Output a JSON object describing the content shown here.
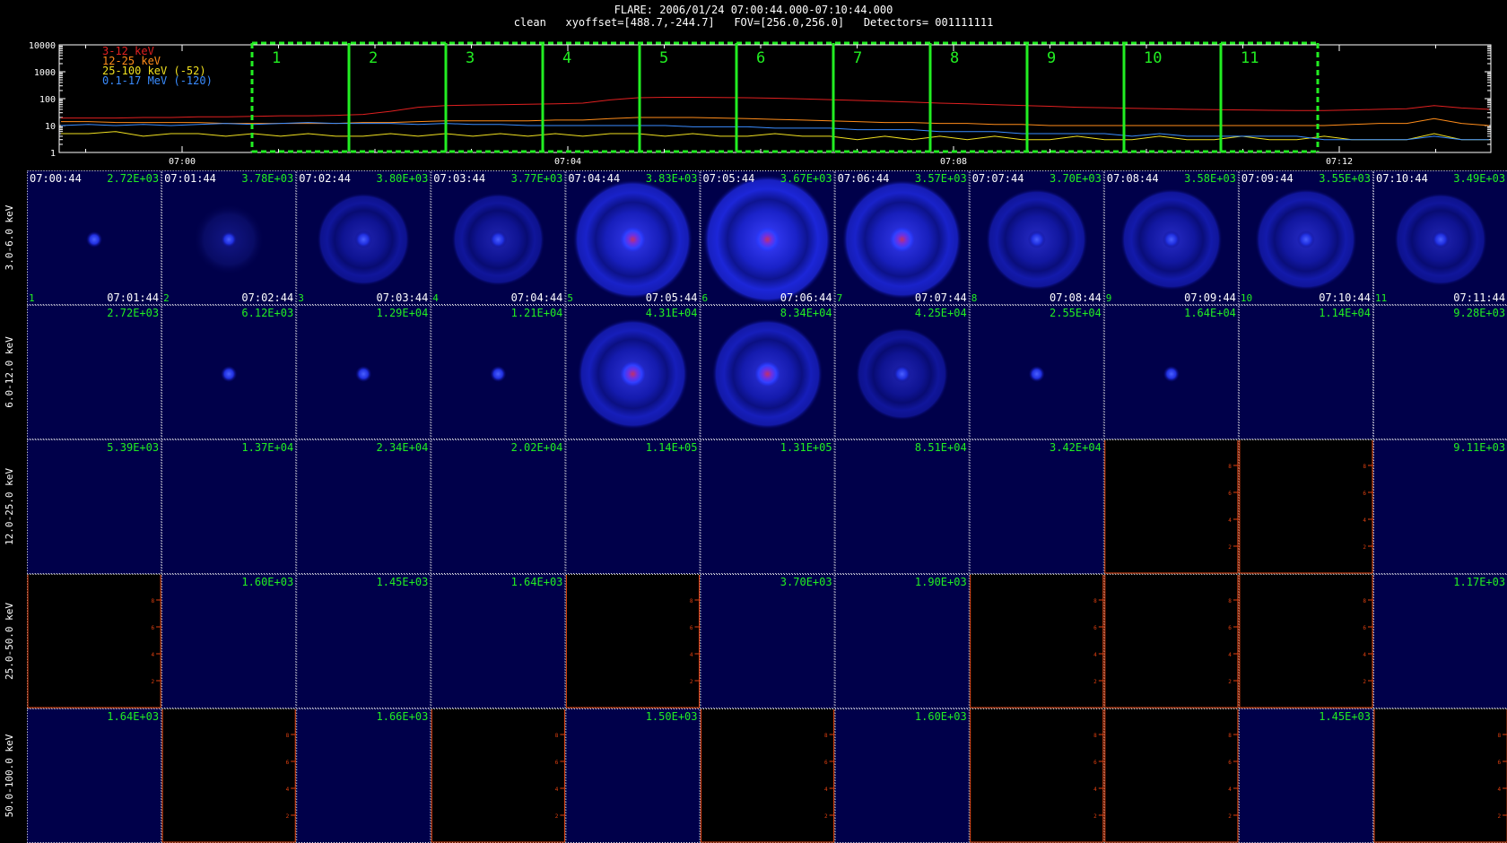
{
  "header": {
    "line1": "FLARE: 2006/01/24 07:00:44.000-07:10:44.000",
    "line2": "clean   xyoffset=[488.7,-244.7]   FOV=[256.0,256.0]   Detectors= 001111111"
  },
  "chart_data": {
    "type": "line",
    "yscale": "log",
    "ylim": [
      1,
      10000
    ],
    "yticks": [
      "1",
      "10",
      "100",
      "1000",
      "10000"
    ],
    "xticks": [
      "07:00",
      "07:04",
      "07:08",
      "07:12"
    ],
    "series": [
      {
        "name": "3-12 keV",
        "color": "#e02020",
        "values": [
          19,
          19,
          19,
          20,
          20,
          21,
          21,
          22,
          23,
          23,
          24,
          26,
          34,
          48,
          55,
          58,
          60,
          62,
          64,
          68,
          90,
          108,
          112,
          112,
          110,
          108,
          104,
          98,
          92,
          86,
          80,
          74,
          68,
          64,
          60,
          56,
          52,
          48,
          46,
          44,
          42,
          40,
          39,
          38,
          37,
          36,
          36,
          38,
          40,
          42,
          55,
          45,
          40
        ]
      },
      {
        "name": "12-25 keV",
        "color": "#ff8c1a",
        "values": [
          14,
          14,
          13,
          13,
          13,
          13,
          12,
          12,
          12,
          12,
          12,
          13,
          13,
          14,
          15,
          15,
          15,
          15,
          16,
          16,
          18,
          20,
          20,
          20,
          19,
          18,
          17,
          16,
          15,
          14,
          13,
          13,
          12,
          12,
          11,
          11,
          10,
          10,
          10,
          10,
          10,
          10,
          10,
          10,
          10,
          10,
          10,
          11,
          12,
          12,
          18,
          12,
          10
        ]
      },
      {
        "name": "25-100 keV (-52)",
        "color": "#f0e020",
        "values": [
          5,
          5,
          6,
          4,
          5,
          5,
          4,
          5,
          4,
          5,
          4,
          4,
          5,
          4,
          5,
          4,
          5,
          4,
          5,
          4,
          5,
          5,
          4,
          5,
          4,
          4,
          5,
          4,
          4,
          3,
          4,
          3,
          4,
          3,
          4,
          3,
          3,
          4,
          3,
          3,
          4,
          3,
          3,
          4,
          3,
          3,
          4,
          3,
          3,
          3,
          5,
          3,
          3
        ]
      },
      {
        "name": "0.1-17 MeV (-120)",
        "color": "#3a8cff",
        "values": [
          10,
          11,
          10,
          11,
          10,
          11,
          12,
          11,
          12,
          13,
          12,
          12,
          12,
          11,
          12,
          11,
          11,
          10,
          10,
          10,
          10,
          10,
          10,
          9,
          9,
          9,
          8,
          8,
          8,
          7,
          7,
          7,
          6,
          6,
          6,
          5,
          5,
          5,
          5,
          4,
          5,
          4,
          4,
          4,
          4,
          4,
          3,
          3,
          3,
          3,
          4,
          3,
          3
        ]
      }
    ],
    "intervals": [
      "1",
      "2",
      "3",
      "4",
      "5",
      "6",
      "7",
      "8",
      "9",
      "10",
      "11"
    ],
    "start_times": [
      "07:00:44",
      "07:01:44",
      "07:02:44",
      "07:03:44",
      "07:04:44",
      "07:05:44",
      "07:06:44",
      "07:07:44",
      "07:08:44",
      "07:09:44",
      "07:10:44"
    ],
    "end_times": [
      "07:01:44",
      "07:02:44",
      "07:03:44",
      "07:04:44",
      "07:05:44",
      "07:06:44",
      "07:07:44",
      "07:08:44",
      "07:09:44",
      "07:10:44",
      "07:11:44"
    ],
    "bands": [
      {
        "label": "3.0-6.0 keV",
        "maxima": [
          "2.72E+03",
          "3.78E+03",
          "3.80E+03",
          "3.77E+03",
          "3.83E+03",
          "3.67E+03",
          "3.57E+03",
          "3.70E+03",
          "3.58E+03",
          "3.55E+03",
          "3.49E+03"
        ],
        "images": [
          "dot",
          "halo1",
          "ring2",
          "ring2",
          "ring5",
          "ring6",
          "ring5",
          "ring3",
          "ring3",
          "ring3",
          "ring2"
        ]
      },
      {
        "label": "6.0-12.0 keV",
        "maxima": [
          "2.72E+03",
          "6.12E+03",
          "1.29E+04",
          "1.21E+04",
          "4.31E+04",
          "8.34E+04",
          "4.25E+04",
          "2.55E+04",
          "1.64E+04",
          "1.14E+04",
          "9.28E+03"
        ],
        "images": [
          "none",
          "dot",
          "dot",
          "dot",
          "ring4",
          "ring4",
          "ring2",
          "dot",
          "dot",
          "none",
          "none"
        ]
      },
      {
        "label": "12.0-25.0 keV",
        "maxima": [
          "5.39E+03",
          "1.37E+04",
          "2.34E+04",
          "2.02E+04",
          "1.14E+05",
          "1.31E+05",
          "8.51E+04",
          "3.42E+04",
          "",
          "",
          "9.11E+03"
        ],
        "images": [
          "none",
          "none",
          "none",
          "none",
          "none",
          "none",
          "none",
          "none",
          "empty",
          "empty",
          "none"
        ]
      },
      {
        "label": "25.0-50.0 keV",
        "maxima": [
          "",
          "1.60E+03",
          "1.45E+03",
          "1.64E+03",
          "",
          "3.70E+03",
          "1.90E+03",
          "",
          "",
          "",
          "1.17E+03"
        ],
        "images": [
          "empty",
          "none",
          "none",
          "none",
          "empty",
          "none",
          "none",
          "empty",
          "empty",
          "empty",
          "none"
        ]
      },
      {
        "label": "50.0-100.0 keV",
        "maxima": [
          "1.64E+03",
          "",
          "1.66E+03",
          "",
          "1.50E+03",
          "",
          "1.60E+03",
          "",
          "",
          "1.45E+03",
          ""
        ],
        "images": [
          "none",
          "empty",
          "none",
          "empty",
          "none",
          "empty",
          "none",
          "empty",
          "empty",
          "none",
          "empty"
        ]
      }
    ],
    "empty_ticks": [
      "2",
      "4",
      "6",
      "8"
    ]
  }
}
